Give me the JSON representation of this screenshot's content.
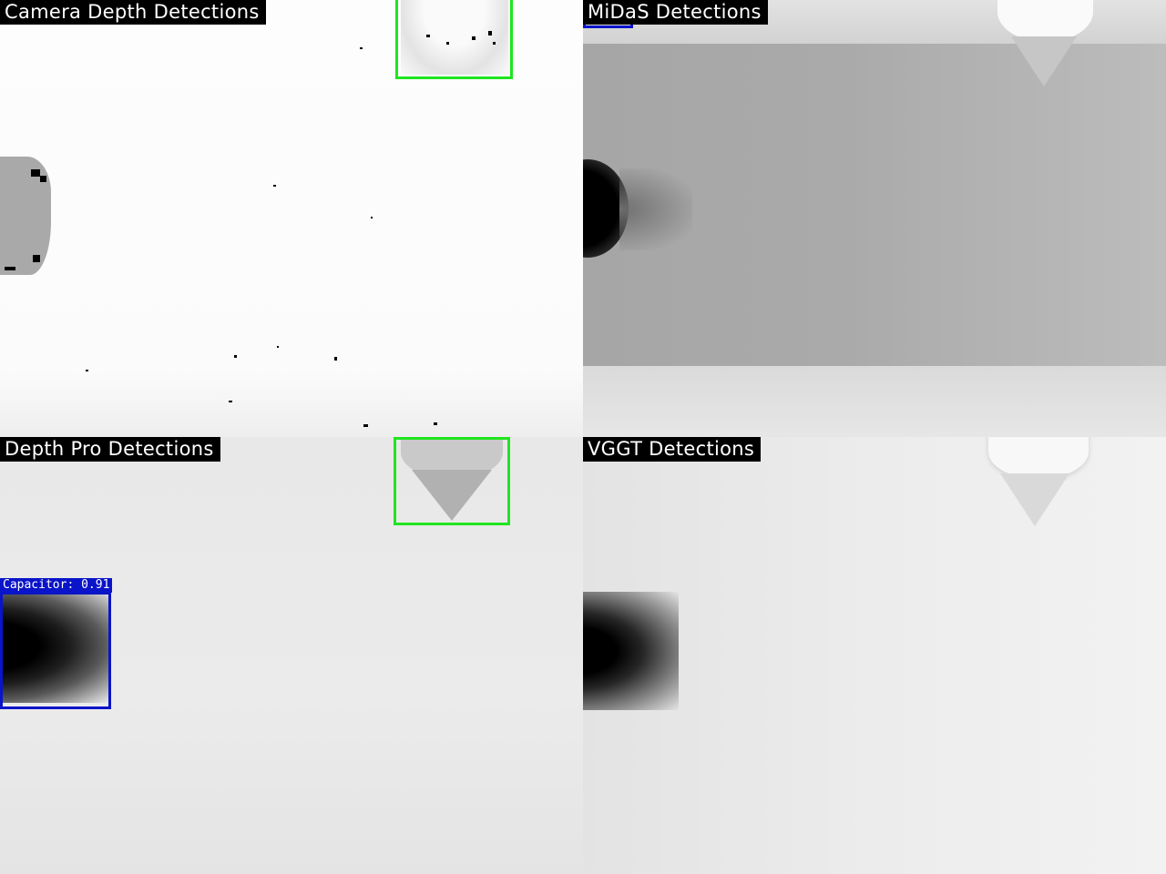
{
  "panels": {
    "camera": {
      "title": "Camera Depth Detections"
    },
    "midas": {
      "title": "MiDaS Detections"
    },
    "depth_pro": {
      "title": "Depth Pro Detections",
      "detection_label": "Capacitor: 0.91"
    },
    "vggt": {
      "title": "VGGT Detections"
    }
  },
  "colors": {
    "green_box": "#1fe51f",
    "blue_box": "#0a14c8",
    "title_bg": "#000000",
    "title_fg": "#ffffff"
  }
}
